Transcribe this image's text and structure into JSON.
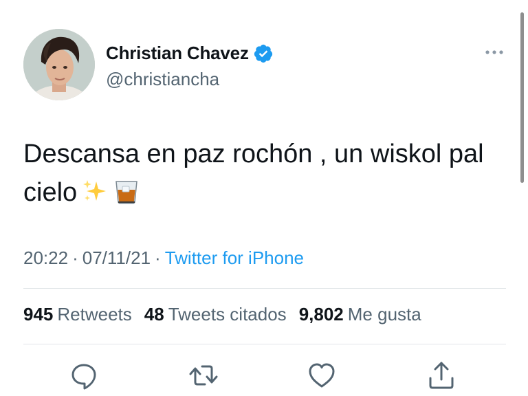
{
  "author": {
    "display_name": "Christian Chavez",
    "handle": "@christiancha"
  },
  "tweet": {
    "text": "Descansa en paz rochón , un wiskol pal cielo",
    "emojis": [
      "sparkles-icon",
      "tumbler-glass-icon"
    ]
  },
  "meta": {
    "time": "20:22",
    "date": "07/11/21",
    "separator": "·",
    "source": "Twitter for iPhone"
  },
  "stats": {
    "retweets_count": "945",
    "retweets_label": "Retweets",
    "quotes_count": "48",
    "quotes_label": "Tweets citados",
    "likes_count": "9,802",
    "likes_label": "Me gusta"
  },
  "colors": {
    "accent": "#1d9bf0",
    "secondary_text": "#536471",
    "primary_text": "#0f1419"
  },
  "actions": [
    "reply-icon",
    "retweet-icon",
    "like-icon",
    "share-icon"
  ]
}
